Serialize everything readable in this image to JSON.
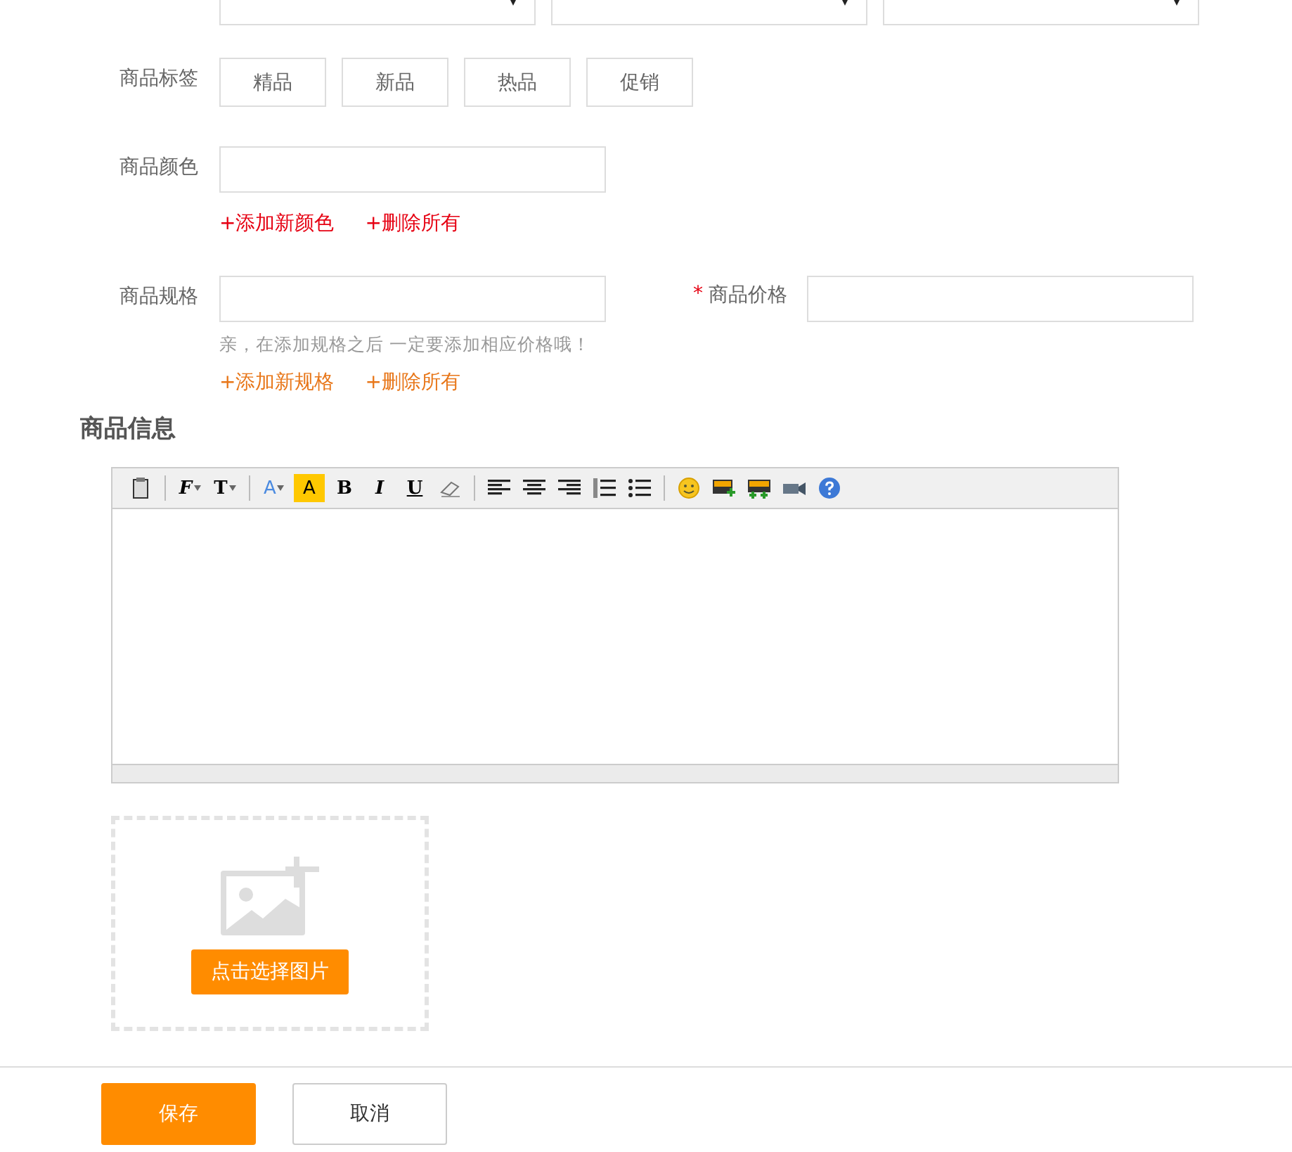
{
  "category": {
    "selects": [
      {
        "kind": "dropdown"
      },
      {
        "kind": "dropdown"
      },
      {
        "kind": "dropdown"
      }
    ]
  },
  "tags": {
    "label": "商品标签",
    "items": [
      {
        "label": "精品",
        "selected": false
      },
      {
        "label": "新品",
        "selected": false
      },
      {
        "label": "热品",
        "selected": false
      },
      {
        "label": "促销",
        "selected": false
      }
    ]
  },
  "color": {
    "label": "商品颜色",
    "links": [
      {
        "text": "+添加新颜色",
        "color": "#e60012"
      },
      {
        "text": "+删除所有",
        "color": "#e60012"
      }
    ]
  },
  "spec": {
    "label": "商品规格",
    "hint": "亲，在添加规格之后 一定要添加相应价格哦！",
    "links": [
      {
        "text": "+添加新规格",
        "color": "#e8771a"
      },
      {
        "text": "+删除所有",
        "color": "#e8771a"
      }
    ]
  },
  "price": {
    "label": "商品价格",
    "mark": "*"
  },
  "info": {
    "heading": "商品信息",
    "toolbar": [
      {
        "kind": "paste"
      },
      {
        "kind": "separator"
      },
      {
        "kind": "font",
        "label": "F"
      },
      {
        "kind": "size",
        "label": "T"
      },
      {
        "kind": "separator"
      },
      {
        "kind": "forecolor",
        "label": "A"
      },
      {
        "kind": "backcolor",
        "label": "A"
      },
      {
        "kind": "bold",
        "label": "B"
      },
      {
        "kind": "italic",
        "label": "I"
      },
      {
        "kind": "underline",
        "label": "U"
      },
      {
        "kind": "eraser"
      },
      {
        "kind": "separator"
      },
      {
        "kind": "align-left"
      },
      {
        "kind": "align-center"
      },
      {
        "kind": "align-right"
      },
      {
        "kind": "ordered-list"
      },
      {
        "kind": "bullet-list"
      },
      {
        "kind": "separator"
      },
      {
        "kind": "emoticon"
      },
      {
        "kind": "image"
      },
      {
        "kind": "multi-image"
      },
      {
        "kind": "video"
      },
      {
        "kind": "help"
      }
    ]
  },
  "upload": {
    "button": "点击选择图片"
  },
  "actions": [
    {
      "label": "保存",
      "kind": "primary"
    },
    {
      "label": "取消",
      "kind": "secondary"
    }
  ]
}
